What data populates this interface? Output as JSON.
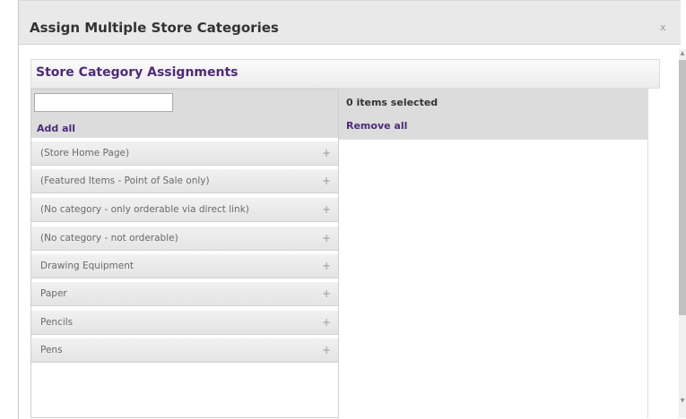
{
  "dialog": {
    "title": "Assign Multiple Store Categories",
    "close_label": "x"
  },
  "section": {
    "title": "Store Category Assignments"
  },
  "left_pane": {
    "filter_value": "",
    "filter_placeholder": "",
    "add_all_label": "Add all",
    "add_icon": "plus-icon",
    "items": [
      {
        "label": "(Store Home Page)"
      },
      {
        "label": "(Featured Items - Point of Sale only)"
      },
      {
        "label": "(No category - only orderable via direct link)"
      },
      {
        "label": "(No category - not orderable)"
      },
      {
        "label": "Drawing Equipment"
      },
      {
        "label": "Paper"
      },
      {
        "label": "Pencils"
      },
      {
        "label": "Pens"
      }
    ]
  },
  "right_pane": {
    "selected_count_text": "0 items selected",
    "remove_all_label": "Remove all"
  },
  "colors": {
    "accent_purple": "#4e2a7a",
    "header_gray": "#e9e9e9",
    "pane_gray": "#dcdcdc"
  }
}
